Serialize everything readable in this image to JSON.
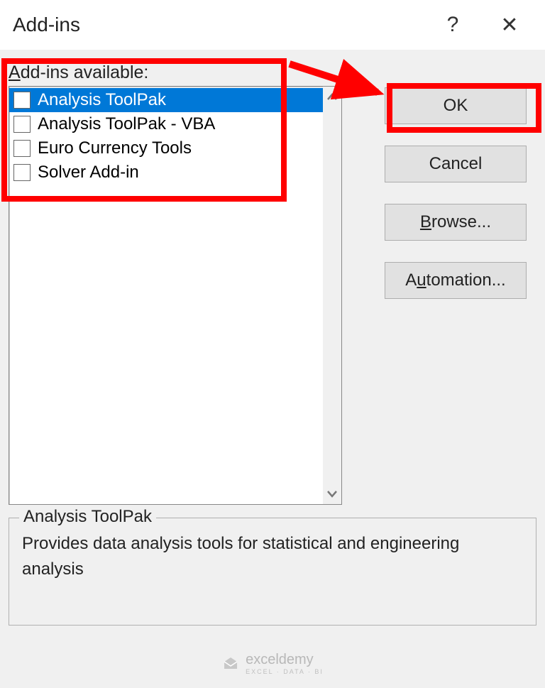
{
  "title": "Add-ins",
  "section_label": {
    "prefix_u": "A",
    "rest": "dd-ins available:"
  },
  "addins": [
    {
      "label": "Analysis ToolPak",
      "selected": true
    },
    {
      "label": "Analysis ToolPak - VBA",
      "selected": false
    },
    {
      "label": "Euro Currency Tools",
      "selected": false
    },
    {
      "label": "Solver Add-in",
      "selected": false
    }
  ],
  "buttons": {
    "ok": "OK",
    "cancel": "Cancel",
    "browse": {
      "prefix": "",
      "u": "B",
      "rest": "rowse..."
    },
    "automation": {
      "prefix": "A",
      "u": "u",
      "rest": "tomation..."
    }
  },
  "detail": {
    "legend": "Analysis ToolPak",
    "description": "Provides data analysis tools for statistical and engineering analysis"
  },
  "watermark": {
    "brand": "exceldemy",
    "sub": "EXCEL · DATA · BI"
  }
}
